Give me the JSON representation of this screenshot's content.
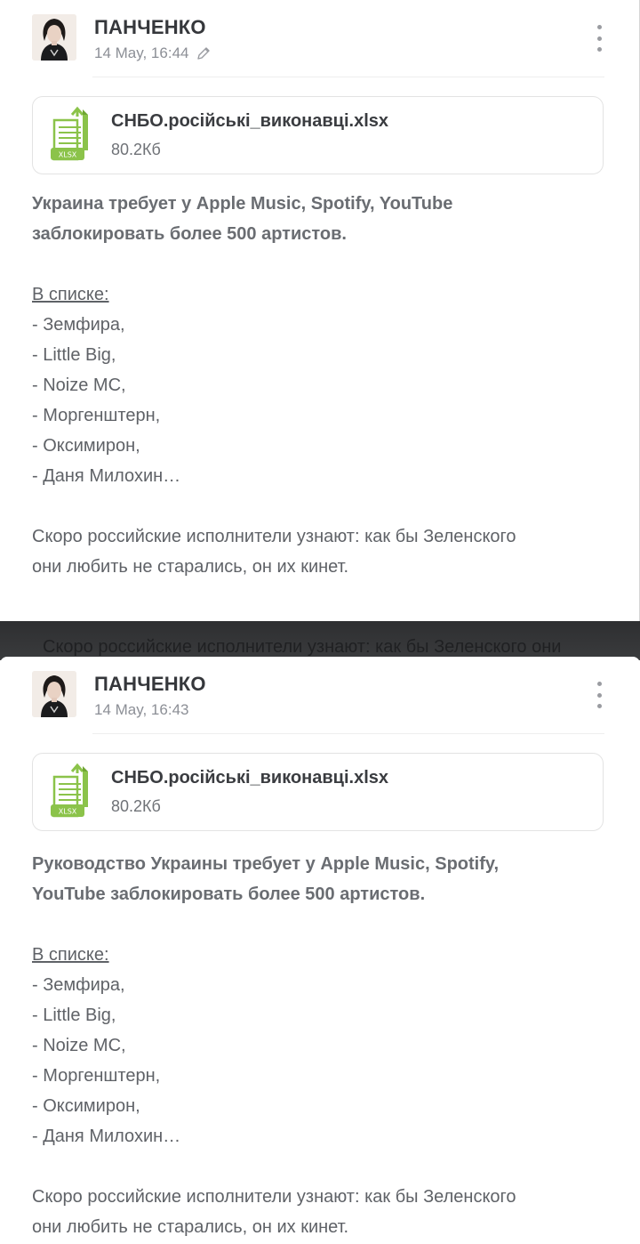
{
  "posts": [
    {
      "author": "ПАНЧЕНКО",
      "date": "14 May, 16:44",
      "edited": true,
      "attachment": {
        "name": "СНБО.російські_виконавці.xlsx",
        "size": "80.2Кб",
        "ext": "XLSX"
      },
      "headline_line1": "Украина требует у Apple Music, Spotify, YouTube",
      "headline_line2": "заблокировать более 500 артистов.",
      "list_label": "В списке:",
      "list_items": [
        "- Земфира,",
        "- Little Big,",
        "- Noize MC,",
        "- Моргенштерн,",
        "- Оксимирон,",
        "- Даня Милохин…"
      ],
      "closing_line1": "Скоро российские исполнители узнают: как бы Зеленского",
      "closing_line2": "они любить не старались, он их кинет."
    },
    {
      "author": "ПАНЧЕНКО",
      "date": "14 May, 16:43",
      "edited": false,
      "attachment": {
        "name": "СНБО.російські_виконавці.xlsx",
        "size": "80.2Кб",
        "ext": "XLSX"
      },
      "headline_line1": "Руководство Украины требует у Apple Music, Spotify,",
      "headline_line2": "YouTube заблокировать более 500 артистов.",
      "list_label": "В списке:",
      "list_items": [
        "- Земфира,",
        "- Little Big,",
        "- Noize MC,",
        "- Моргенштерн,",
        "- Оксимирон,",
        "- Даня Милохин…"
      ],
      "closing_line1": "Скоро российские исполнители узнают: как бы Зеленского",
      "closing_line2": "они любить не старались, он их кинет."
    }
  ],
  "background_strip_text": "Скоро российские исполнители узнают: как бы Зеленского они",
  "colors": {
    "file_green": "#8bc34a",
    "text": "#5f6267",
    "author": "#35373b",
    "meta": "#8c8f96"
  },
  "icons": {
    "menu": "more-vertical-icon",
    "edit": "pencil-icon",
    "file": "xlsx-file-icon"
  }
}
